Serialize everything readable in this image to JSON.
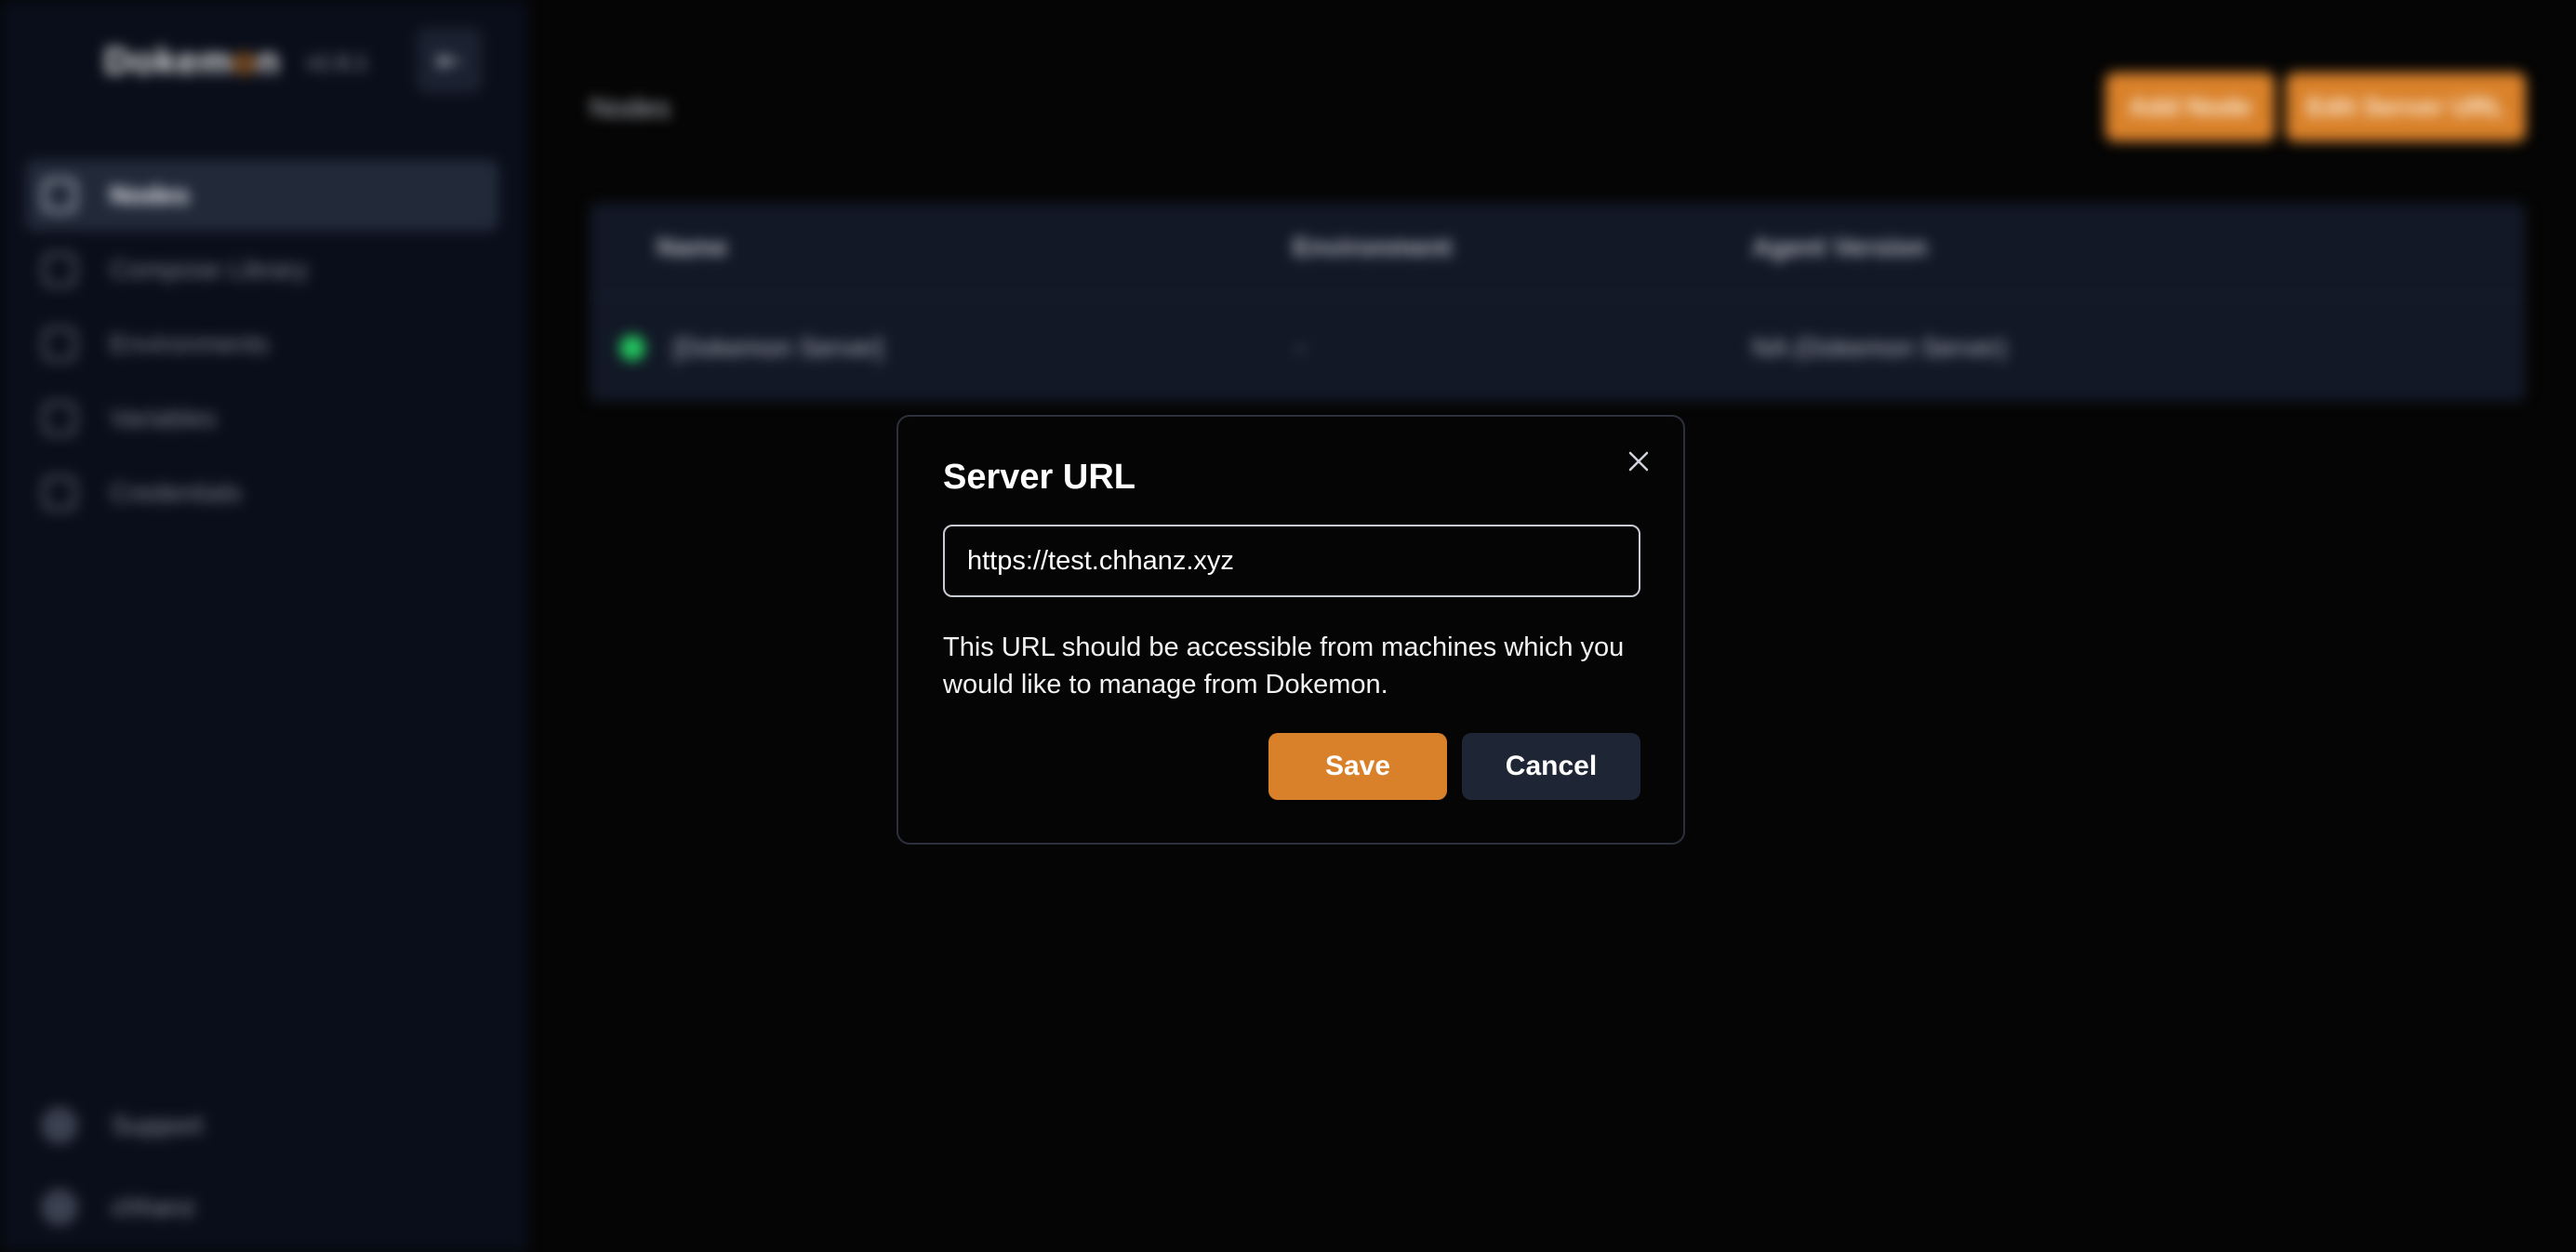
{
  "app": {
    "logo_prefix": "Dokem",
    "logo_accent": "o",
    "logo_suffix": "n",
    "version": "v1.6.1",
    "accent_color": "#d9812a"
  },
  "sidebar": {
    "items": [
      {
        "label": "Nodes",
        "icon": "server-icon",
        "active": true
      },
      {
        "label": "Compose Library",
        "icon": "compose-icon",
        "active": false
      },
      {
        "label": "Environments",
        "icon": "environment-icon",
        "active": false
      },
      {
        "label": "Variables",
        "icon": "variable-icon",
        "active": false
      },
      {
        "label": "Credentials",
        "icon": "lock-icon",
        "active": false
      }
    ],
    "bottom": [
      {
        "label": "Support",
        "icon": "help-icon"
      },
      {
        "label": "chhanz",
        "icon": "user-icon"
      }
    ]
  },
  "main": {
    "title": "Nodes",
    "add_node_label": "Add Node",
    "edit_server_url_label": "Edit Server URL",
    "table": {
      "headers": [
        "Name",
        "Environment",
        "Agent Version"
      ],
      "rows": [
        {
          "name": "[Dokemon Server]",
          "environment": "-",
          "agent_version": "NA (Dokemon Server)",
          "status": "online"
        }
      ]
    }
  },
  "dialog": {
    "title": "Server URL",
    "url_value": "https://test.chhanz.xyz",
    "help_text": "This URL should be accessible from machines which you would like to manage from Dokemon.",
    "save_label": "Save",
    "cancel_label": "Cancel"
  }
}
